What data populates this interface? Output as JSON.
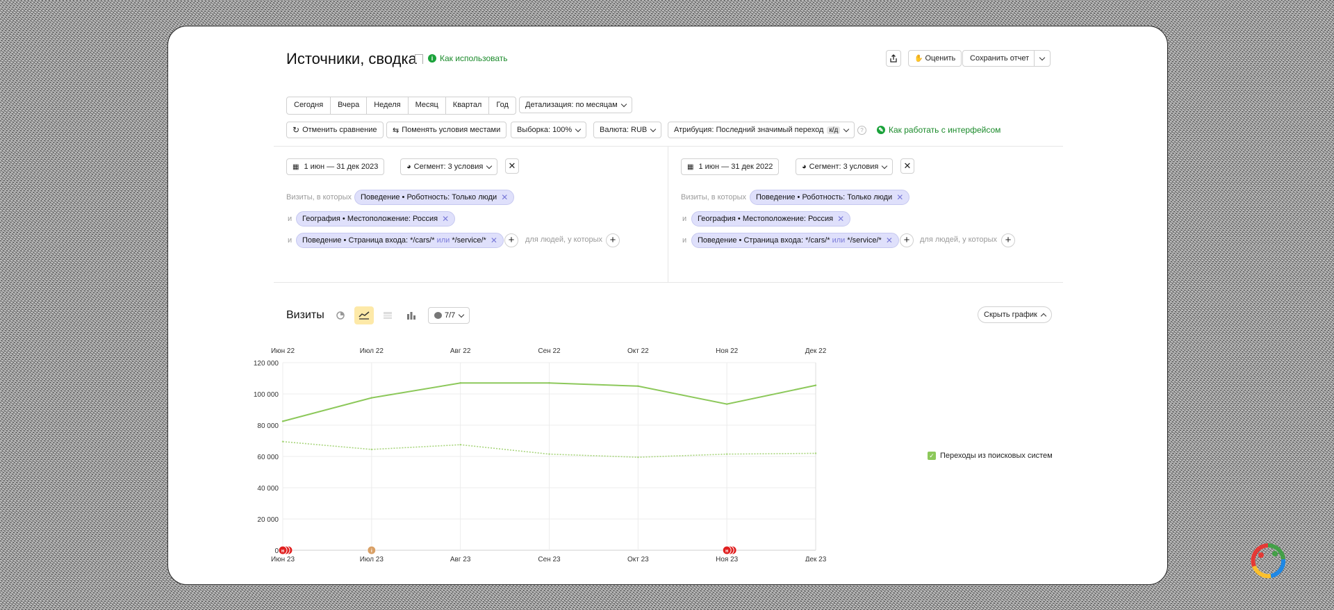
{
  "header": {
    "title": "Источники, сводка",
    "help_link": "Как использовать",
    "share_icon": "share-icon",
    "rate_label": "Оценить",
    "save_label": "Сохранить отчет"
  },
  "periods": [
    "Сегодня",
    "Вчера",
    "Неделя",
    "Месяц",
    "Квартал",
    "Год"
  ],
  "detail_label": "Детализация: по месяцам",
  "toolbar": {
    "cancel_compare": "Отменить сравнение",
    "swap_conditions": "Поменять условия местами",
    "sample": "Выборка: 100%",
    "currency": "Валюта: RUB",
    "attribution": "Атрибуция: Последний значимый переход",
    "attribution_badge": "к/д",
    "interface_help": "Как работать с интерфейсом"
  },
  "left_segment": {
    "date_range": "1 июн — 31 дек 2023",
    "segment_label": "Сегмент: 3 условия",
    "visits_prefix": "Визиты, в которых",
    "and_label": "и",
    "chip1": "Поведение • Роботность: Только люди",
    "chip2": "География • Местоположение: Россия",
    "chip3_a": "Поведение • Страница входа: *",
    "chip3_b": "/cars/*",
    "chip3_or": "или",
    "chip3_c": "*/service/*",
    "people_text": "для людей, у которых"
  },
  "right_segment": {
    "date_range": "1 июн — 31 дек 2022",
    "segment_label": "Сегмент: 3 условия",
    "visits_prefix": "Визиты, в которых",
    "and_label": "и",
    "chip1": "Поведение • Роботность: Только люди",
    "chip2": "География • Местоположение: Россия",
    "chip3_a": "Поведение • Страница входа: *",
    "chip3_b": "/cars/*",
    "chip3_or": "или",
    "chip3_c": "*/service/*",
    "people_text": "для людей, у которых"
  },
  "graph_panel": {
    "title": "Визиты",
    "count_label": "7/7",
    "hide_graph": "Скрыть график"
  },
  "chart_data": {
    "type": "line",
    "x_top": [
      "Июн 22",
      "Июл 22",
      "Авг 22",
      "Сен 22",
      "Окт 22",
      "Ноя 22",
      "Дек 22"
    ],
    "x_bottom": [
      "Июн 23",
      "Июл 23",
      "Авг 23",
      "Сен 23",
      "Окт 23",
      "Ноя 23",
      "Дек 23"
    ],
    "y_ticks": [
      "0",
      "20 000",
      "40 000",
      "60 000",
      "80 000",
      "100 000",
      "120 000"
    ],
    "ylim": [
      0,
      120000
    ],
    "series": [
      {
        "name": "Переходы из поисковых систем",
        "style": "solid",
        "color": "#8cc85a",
        "values": [
          82500,
          97500,
          107000,
          107000,
          105000,
          93500,
          105500
        ]
      },
      {
        "style": "dotted",
        "color": "#a8d57c",
        "values": [
          69500,
          64500,
          67500,
          61500,
          59500,
          61500,
          62000
        ]
      }
    ],
    "legend_label": "Переходы из поисковых систем",
    "grid": true,
    "markers": [
      {
        "x_index": 0,
        "color": "#e02020",
        "count": 3,
        "label": "н"
      },
      {
        "x_index": 1,
        "color": "#d9a066",
        "count": 1,
        "label": "i"
      },
      {
        "x_index": 5,
        "color": "#e02020",
        "count": 3,
        "label": "н"
      }
    ]
  }
}
